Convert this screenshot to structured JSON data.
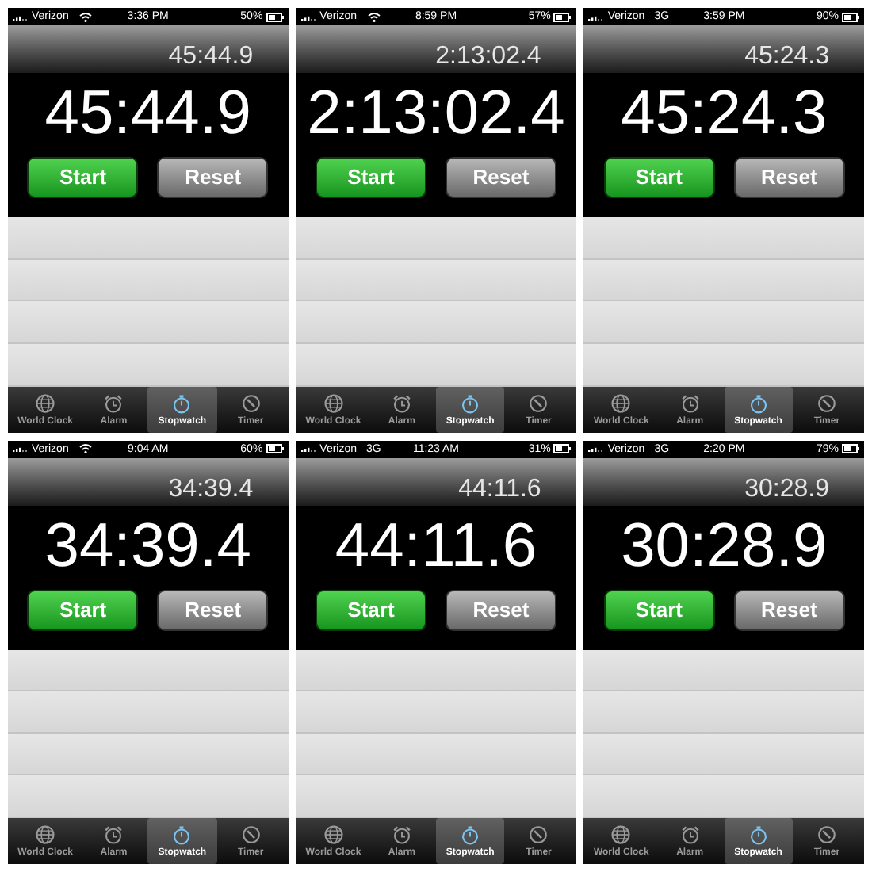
{
  "screens": [
    {
      "status": {
        "carrier": "Verizon",
        "network": {
          "kind": "wifi"
        },
        "time": "3:36 PM",
        "battery": "50%"
      },
      "lap_time": "45:44.9",
      "main_time": "45:44.9",
      "buttons": [
        "Start",
        "Reset"
      ],
      "tabs": [
        {
          "label": "World Clock",
          "kind": "globe",
          "selected": false
        },
        {
          "label": "Alarm",
          "kind": "alarm",
          "selected": false
        },
        {
          "label": "Stopwatch",
          "kind": "stopwatch",
          "selected": true
        },
        {
          "label": "Timer",
          "kind": "timer",
          "selected": false
        }
      ]
    },
    {
      "status": {
        "carrier": "Verizon",
        "network": {
          "kind": "wifi"
        },
        "time": "8:59 PM",
        "battery": "57%"
      },
      "lap_time": "2:13:02.4",
      "main_time": "2:13:02.4",
      "buttons": [
        "Start",
        "Reset"
      ],
      "tabs": [
        {
          "label": "World Clock",
          "kind": "globe",
          "selected": false
        },
        {
          "label": "Alarm",
          "kind": "alarm",
          "selected": false
        },
        {
          "label": "Stopwatch",
          "kind": "stopwatch",
          "selected": true
        },
        {
          "label": "Timer",
          "kind": "timer",
          "selected": false
        }
      ]
    },
    {
      "status": {
        "carrier": "Verizon",
        "network": {
          "kind": "text",
          "label": "3G"
        },
        "time": "3:59 PM",
        "battery": "90%"
      },
      "lap_time": "45:24.3",
      "main_time": "45:24.3",
      "buttons": [
        "Start",
        "Reset"
      ],
      "tabs": [
        {
          "label": "World Clock",
          "kind": "globe",
          "selected": false
        },
        {
          "label": "Alarm",
          "kind": "alarm",
          "selected": false
        },
        {
          "label": "Stopwatch",
          "kind": "stopwatch",
          "selected": true
        },
        {
          "label": "Timer",
          "kind": "timer",
          "selected": false
        }
      ]
    },
    {
      "status": {
        "carrier": "Verizon",
        "network": {
          "kind": "wifi"
        },
        "time": "9:04 AM",
        "battery": "60%"
      },
      "lap_time": "34:39.4",
      "main_time": "34:39.4",
      "buttons": [
        "Start",
        "Reset"
      ],
      "tabs": [
        {
          "label": "World Clock",
          "kind": "globe",
          "selected": false
        },
        {
          "label": "Alarm",
          "kind": "alarm",
          "selected": false
        },
        {
          "label": "Stopwatch",
          "kind": "stopwatch",
          "selected": true
        },
        {
          "label": "Timer",
          "kind": "timer",
          "selected": false
        }
      ]
    },
    {
      "status": {
        "carrier": "Verizon",
        "network": {
          "kind": "text",
          "label": "3G"
        },
        "time": "11:23 AM",
        "battery": "31%"
      },
      "lap_time": "44:11.6",
      "main_time": "44:11.6",
      "buttons": [
        "Start",
        "Reset"
      ],
      "tabs": [
        {
          "label": "World Clock",
          "kind": "globe",
          "selected": false
        },
        {
          "label": "Alarm",
          "kind": "alarm",
          "selected": false
        },
        {
          "label": "Stopwatch",
          "kind": "stopwatch",
          "selected": true
        },
        {
          "label": "Timer",
          "kind": "timer",
          "selected": false
        }
      ]
    },
    {
      "status": {
        "carrier": "Verizon",
        "network": {
          "kind": "text",
          "label": "3G"
        },
        "time": "2:20 PM",
        "battery": "79%"
      },
      "lap_time": "30:28.9",
      "main_time": "30:28.9",
      "buttons": [
        "Start",
        "Reset"
      ],
      "tabs": [
        {
          "label": "World Clock",
          "kind": "globe",
          "selected": false
        },
        {
          "label": "Alarm",
          "kind": "alarm",
          "selected": false
        },
        {
          "label": "Stopwatch",
          "kind": "stopwatch",
          "selected": true
        },
        {
          "label": "Timer",
          "kind": "timer",
          "selected": false
        }
      ]
    }
  ]
}
